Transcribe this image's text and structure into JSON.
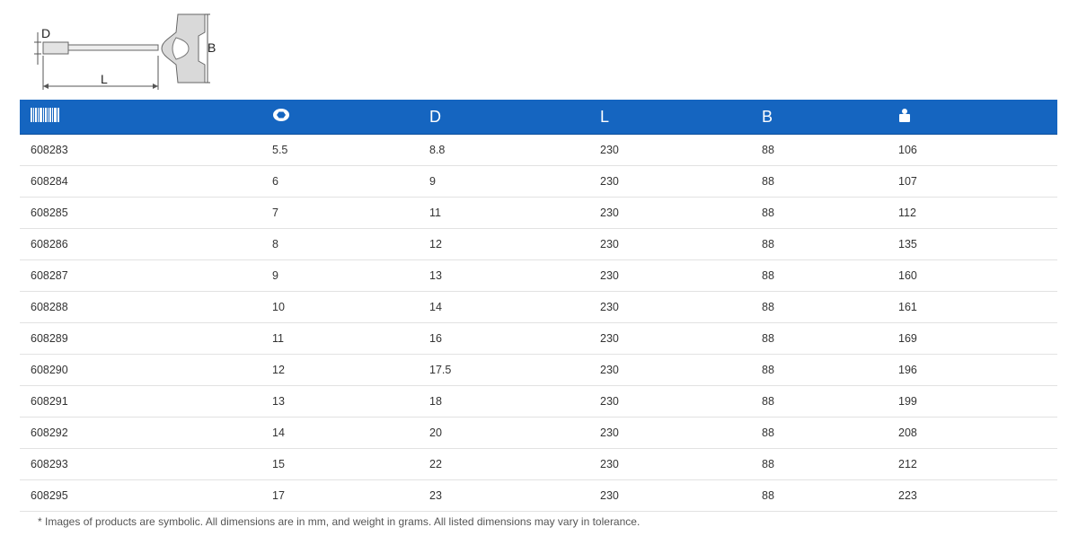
{
  "diagram": {
    "labels": {
      "d": "D",
      "b": "B",
      "l": "L"
    }
  },
  "table": {
    "headers": [
      {
        "icon": "barcode-icon"
      },
      {
        "icon": "hex-socket-icon"
      },
      {
        "label": "D"
      },
      {
        "label": "L"
      },
      {
        "label": "B"
      },
      {
        "icon": "weight-icon"
      }
    ],
    "rows": [
      [
        "608283",
        "5.5",
        "8.8",
        "230",
        "88",
        "106"
      ],
      [
        "608284",
        "6",
        "9",
        "230",
        "88",
        "107"
      ],
      [
        "608285",
        "7",
        "11",
        "230",
        "88",
        "112"
      ],
      [
        "608286",
        "8",
        "12",
        "230",
        "88",
        "135"
      ],
      [
        "608287",
        "9",
        "13",
        "230",
        "88",
        "160"
      ],
      [
        "608288",
        "10",
        "14",
        "230",
        "88",
        "161"
      ],
      [
        "608289",
        "11",
        "16",
        "230",
        "88",
        "169"
      ],
      [
        "608290",
        "12",
        "17.5",
        "230",
        "88",
        "196"
      ],
      [
        "608291",
        "13",
        "18",
        "230",
        "88",
        "199"
      ],
      [
        "608292",
        "14",
        "20",
        "230",
        "88",
        "208"
      ],
      [
        "608293",
        "15",
        "22",
        "230",
        "88",
        "212"
      ],
      [
        "608295",
        "17",
        "23",
        "230",
        "88",
        "223"
      ]
    ]
  },
  "footnote": "* Images of products are symbolic. All dimensions are in mm, and weight in grams. All listed dimensions may vary in tolerance.",
  "colors": {
    "header_bg": "#1565c0",
    "header_text": "#ffffff"
  }
}
